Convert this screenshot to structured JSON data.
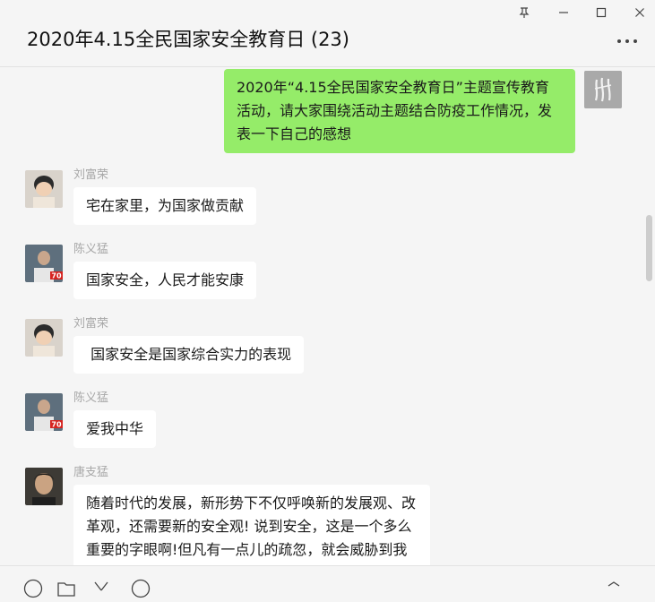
{
  "window": {
    "title": "2020年4.15全民国家安全教育日 (23)",
    "pin_glyph": "⽍",
    "minimize_glyph": "─",
    "maximize_glyph": "☐",
    "close_glyph": "✕"
  },
  "messages": [
    {
      "sender": "",
      "mine": true,
      "text": "2020年“4.15全民国家安全教育日”主题宣传教育活动，请大家围绕活动主题结合防疫工作情况，发表一下自己的感想"
    },
    {
      "sender": "刘富荣",
      "mine": false,
      "text": "宅在家里，为国家做贡献"
    },
    {
      "sender": "陈义猛",
      "mine": false,
      "text": "国家安全，人民才能安康"
    },
    {
      "sender": "刘富荣",
      "mine": false,
      "text": " 国家安全是国家综合实力的表现"
    },
    {
      "sender": "陈义猛",
      "mine": false,
      "text": "爱我中华"
    },
    {
      "sender": "唐支猛",
      "mine": false,
      "text": "随着时代的发展，新形势下不仅呼唤新的发展观、改革观，还需要新的安全观! 说到安全，这是一个多么重要的字眼啊!但凡有一点儿的疏忽，就会威胁到我们的生命，迷路走失，交通事"
    }
  ],
  "colors": {
    "own_bubble": "#95ec69",
    "other_bubble": "#ffffff",
    "background": "#f5f5f5",
    "sender_name": "#a8a8a8"
  },
  "icons": {
    "toolbar": [
      "emoji-icon",
      "folder-icon",
      "scissors-icon",
      "chat-history-icon",
      "video-call-icon"
    ]
  }
}
